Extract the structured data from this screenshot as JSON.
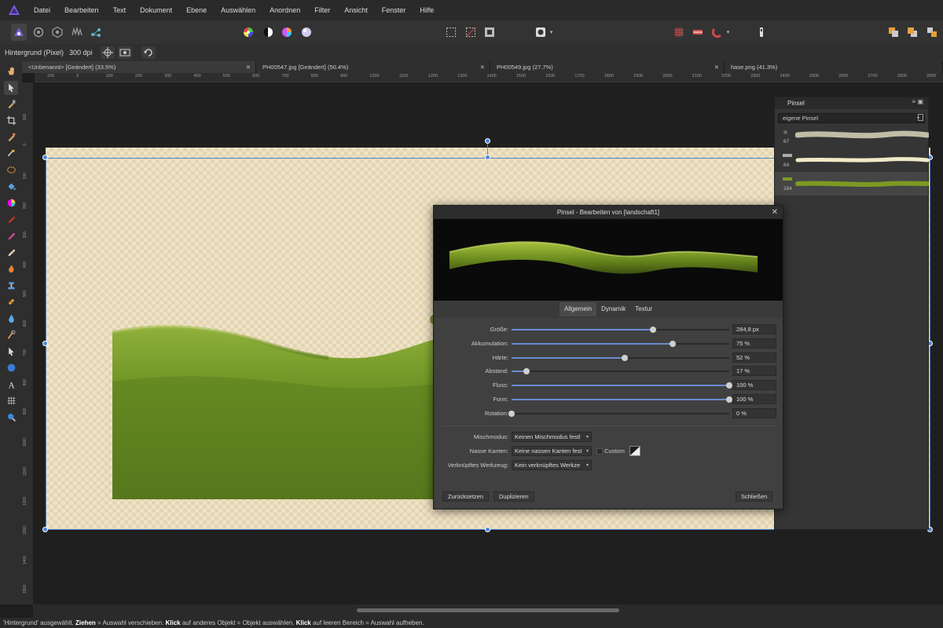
{
  "app": {
    "name": "Affinity Photo",
    "accent": "#5a3fbf"
  },
  "menu": {
    "items": [
      "Datei",
      "Bearbeiten",
      "Text",
      "Dokument",
      "Ebene",
      "Auswählen",
      "Anordnen",
      "Filter",
      "Ansicht",
      "Fenster",
      "Hilfe"
    ]
  },
  "context": {
    "layer": "Hintergrund (Pixel)",
    "dpi": "300 dpi"
  },
  "tabs": [
    {
      "label": "<Unbenannt> [Geändert] (33.5%)"
    },
    {
      "label": "PH00547.jpg [Geändert] (50.4%)"
    },
    {
      "label": "PH00549.jpg (27.7%)"
    },
    {
      "label": "hase.png (41.3%)"
    }
  ],
  "ruler": {
    "top_ticks": [
      "100",
      "0",
      "100",
      "200",
      "300",
      "400",
      "500",
      "600",
      "700",
      "800",
      "900",
      "1000",
      "1100",
      "1200",
      "1300",
      "1400",
      "1500",
      "1600",
      "1700",
      "1800",
      "1900",
      "2000",
      "2100",
      "2200",
      "2300",
      "2400",
      "2500",
      "2600",
      "2700",
      "2800",
      "2900",
      "3000"
    ],
    "left_ticks": [
      "100",
      "0",
      "100",
      "200",
      "300",
      "400",
      "500",
      "600",
      "700",
      "800",
      "900",
      "1000",
      "1100",
      "1200",
      "1300",
      "1400",
      "1500"
    ]
  },
  "pinsel_panel": {
    "title": "Pinsel",
    "category": "eigene Pinsel",
    "brushes": [
      {
        "size": "67"
      },
      {
        "size": "64"
      },
      {
        "size": "284"
      }
    ]
  },
  "brush_dialog": {
    "title": "Pinsel - Bearbeiten von [landschaft1]",
    "tabs": [
      "Allgemein",
      "Dynamik",
      "Textur"
    ],
    "active_tab": "Allgemein",
    "sliders": [
      {
        "label": "Größe:",
        "value": "284,8 px",
        "fraction": 0.65
      },
      {
        "label": "Akkumulation:",
        "value": "75 %",
        "fraction": 0.74
      },
      {
        "label": "Härte:",
        "value": "52 %",
        "fraction": 0.52
      },
      {
        "label": "Abstand:",
        "value": "17 %",
        "fraction": 0.07
      },
      {
        "label": "Fluss:",
        "value": "100 %",
        "fraction": 1.0
      },
      {
        "label": "Form:",
        "value": "100 %",
        "fraction": 1.0
      },
      {
        "label": "Rotation:",
        "value": "0 %",
        "fraction": 0.0
      }
    ],
    "blend_mode_label": "Mischmodus:",
    "blend_mode_value": "Keinen Mischmodus festl",
    "wet_edges_label": "Nasse Kanten:",
    "wet_edges_value": "Keine nassen Kanten fest",
    "custom_label": "Custom",
    "linked_tool_label": "Verknüpftes Werkzeug:",
    "linked_tool_value": "Kein verknüpftes Werkze",
    "btn_reset": "Zurücksetzen",
    "btn_duplicate": "Duplizieren",
    "btn_close": "Schließen"
  },
  "status": {
    "parts": [
      {
        "t": "'Hintergrund' ausgewählt. ",
        "b": false
      },
      {
        "t": "Ziehen",
        "b": true
      },
      {
        "t": " = Auswahl verschieben. ",
        "b": false
      },
      {
        "t": "Klick",
        "b": true
      },
      {
        "t": " auf anderes Objekt = Objekt auswählen. ",
        "b": false
      },
      {
        "t": "Klick",
        "b": true
      },
      {
        "t": " auf leeren Bereich = Auswahl aufheben.",
        "b": false
      }
    ]
  }
}
